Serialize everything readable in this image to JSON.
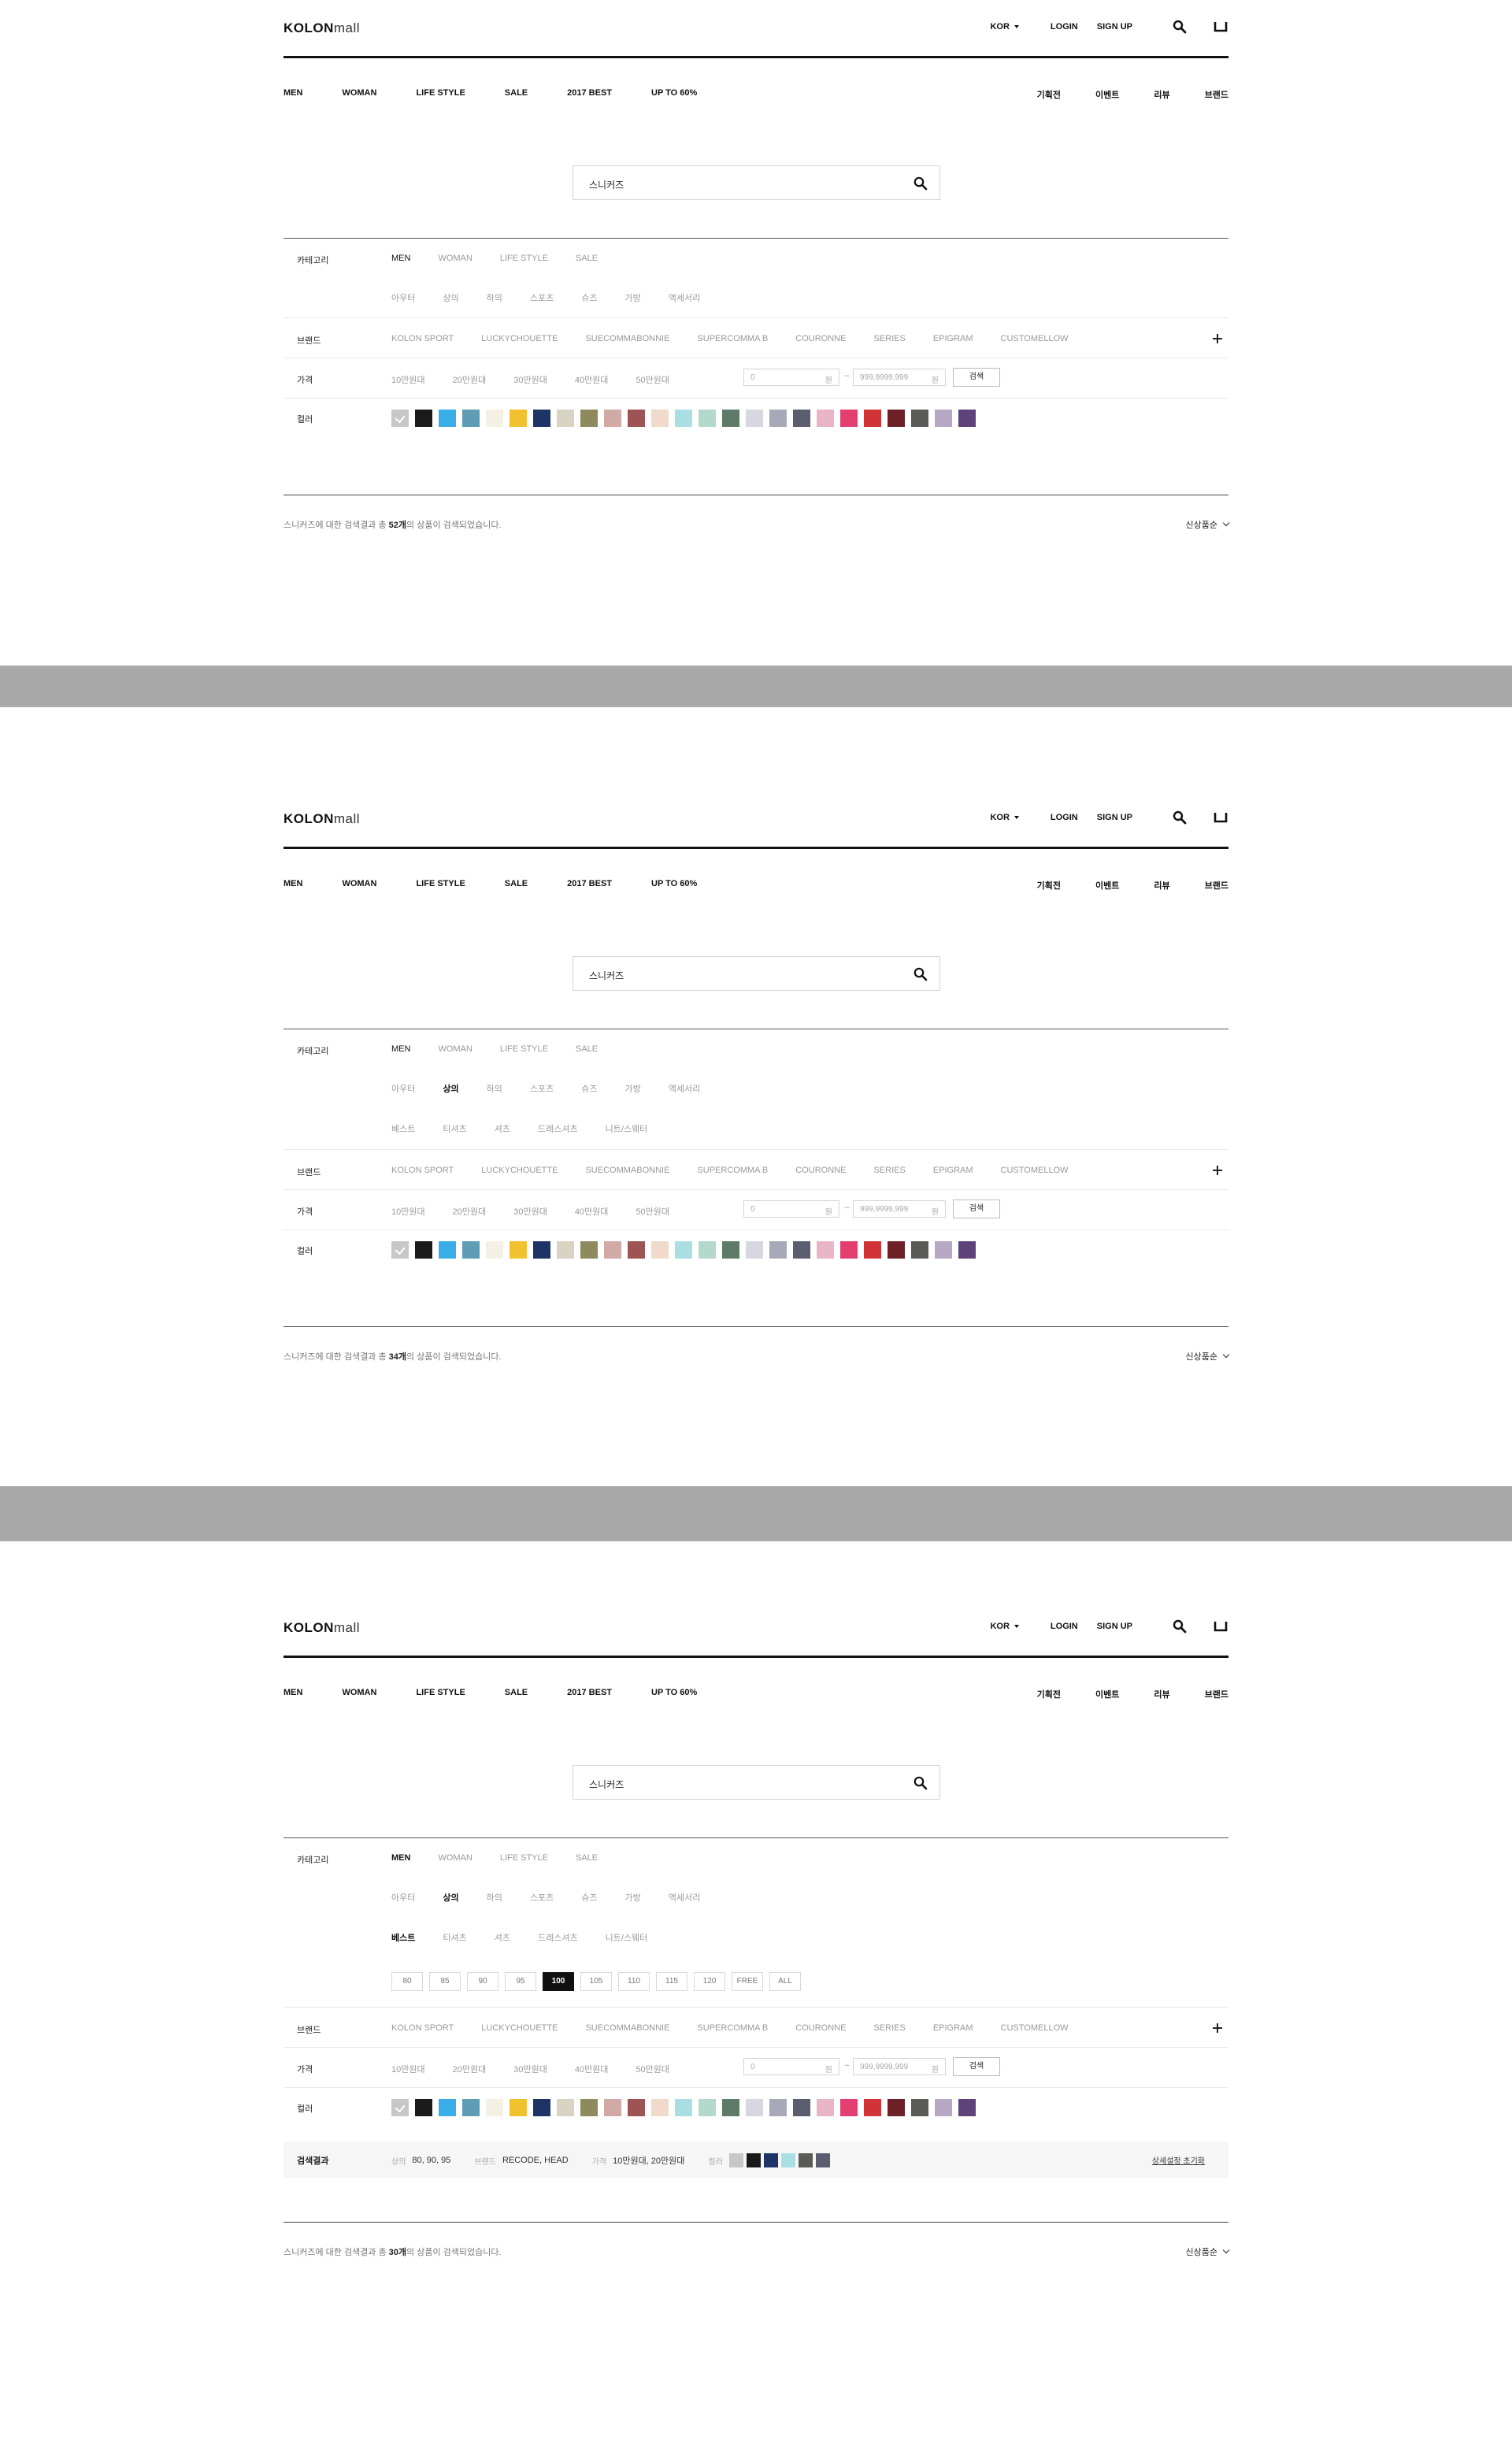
{
  "header": {
    "logo_bold": "KOLON",
    "logo_light": "mall",
    "lang": "KOR",
    "login": "LOGIN",
    "signup": "SIGN UP",
    "gnb_left": [
      "MEN",
      "WOMAN",
      "LIFE STYLE",
      "SALE",
      "2017 BEST",
      "UP TO 60%"
    ],
    "gnb_right": [
      "기획전",
      "이벤트",
      "리뷰",
      "브랜드"
    ]
  },
  "search": {
    "value": "스니커즈"
  },
  "filter": {
    "category_label": "카테고리",
    "categories": [
      "MEN",
      "WOMAN",
      "LIFE STYLE",
      "SALE"
    ],
    "subcategories": [
      "아우터",
      "상의",
      "하의",
      "스포츠",
      "슈즈",
      "가방",
      "액세서리"
    ],
    "subsub": [
      "베스트",
      "티셔츠",
      "셔츠",
      "드레스셔츠",
      "니트/스웨터"
    ],
    "sizes": [
      "80",
      "85",
      "90",
      "95",
      "100",
      "105",
      "110",
      "115",
      "120",
      "FREE",
      "ALL"
    ],
    "brand_label": "브랜드",
    "brands": [
      "KOLON SPORT",
      "LUCKYCHOUETTE",
      "SUECOMMABONNIE",
      "SUPERCOMMA B",
      "COURONNE",
      "SERIES",
      "EPIGRAM",
      "CUSTOMELLOW"
    ],
    "price_label": "가격",
    "prices": [
      "10만원대",
      "20만원대",
      "30만원대",
      "40만원대",
      "50만원대"
    ],
    "price_min": "0",
    "price_max": "999,9999,999",
    "won": "원",
    "tilde": "~",
    "price_button": "검색",
    "color_label": "컬러",
    "colors": [
      "#c7c7c7",
      "#1a1a1a",
      "#3aaee8",
      "#5e9db3",
      "#f4f1e4",
      "#f2c12e",
      "#1c3466",
      "#d9d3c3",
      "#8e8a5e",
      "#d2aaa5",
      "#9c5454",
      "#f0dacb",
      "#a9dfe3",
      "#b4d9cc",
      "#5e7a69",
      "#d6d7e0",
      "#a7a9b8",
      "#5a5e6f",
      "#e9b4c6",
      "#e23f70",
      "#d23336",
      "#6d2127",
      "#5a5b57",
      "#b7a9c6",
      "#5d4379"
    ]
  },
  "panels": [
    {
      "count_text_pre": "스니커즈에 대한 검색결과 총 ",
      "count": "52개",
      "count_text_post": "의 상품이 검색되었습니다."
    },
    {
      "count_text_pre": "스니커즈에 대한 검색결과 총 ",
      "count": "34개",
      "count_text_post": "의 상품이 검색되었습니다."
    },
    {
      "count_text_pre": "스니커즈에 대한 검색결과 총 ",
      "count": "30개",
      "count_text_post": "의 상품이 검색되었습니다."
    }
  ],
  "sort": "신상품순",
  "summary": {
    "title": "검색결과",
    "size_key": "상의",
    "size_val": "80, 90, 95",
    "brand_key": "브랜드",
    "brand_val": "RECODE, HEAD",
    "price_key": "가격",
    "price_val": "10만원대, 20만원대",
    "color_key": "컬러",
    "colors": [
      "#c7c7c7",
      "#1a1a1a",
      "#1c3466",
      "#a9dfe3",
      "#5a5b57",
      "#5a5e6f"
    ],
    "reset": "상세설정 초기화"
  }
}
